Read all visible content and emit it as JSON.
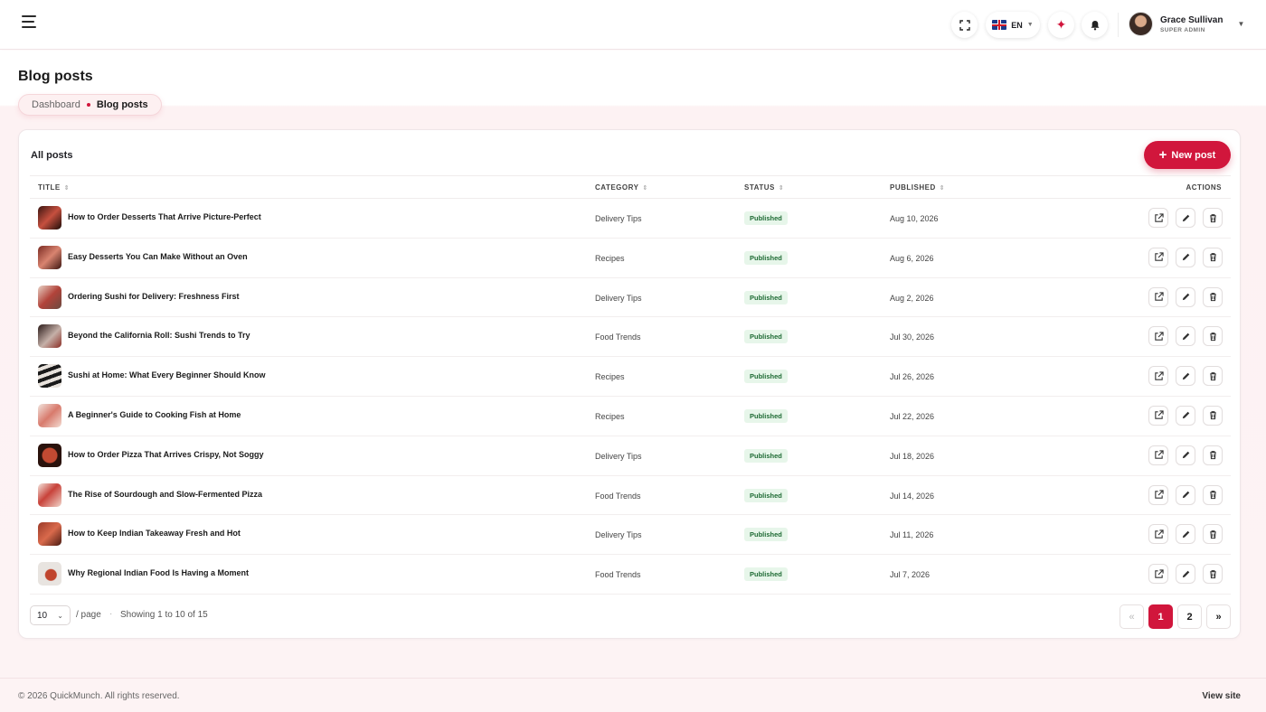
{
  "topbar": {
    "language": "EN",
    "user": {
      "name": "Grace Sullivan",
      "role": "SUPER ADMIN"
    },
    "icons": [
      "menu-icon",
      "fullscreen-icon",
      "uk-flag-icon",
      "sparkle-icon",
      "bell-icon",
      "chevron-down-icon"
    ]
  },
  "page": {
    "title": "Blog posts",
    "breadcrumb": {
      "home": "Dashboard",
      "current": "Blog posts"
    }
  },
  "card": {
    "title": "All posts",
    "new_button": "New post",
    "columns": {
      "title": "TITLE",
      "category": "CATEGORY",
      "status": "STATUS",
      "published": "PUBLISHED",
      "actions": "ACTIONS"
    },
    "rows": [
      {
        "title": "How to Order Desserts That Arrive Picture-Perfect",
        "category": "Delivery Tips",
        "status": "Published",
        "published": "Aug 10, 2026"
      },
      {
        "title": "Easy Desserts You Can Make Without an Oven",
        "category": "Recipes",
        "status": "Published",
        "published": "Aug 6, 2026"
      },
      {
        "title": "Ordering Sushi for Delivery: Freshness First",
        "category": "Delivery Tips",
        "status": "Published",
        "published": "Aug 2, 2026"
      },
      {
        "title": "Beyond the California Roll: Sushi Trends to Try",
        "category": "Food Trends",
        "status": "Published",
        "published": "Jul 30, 2026"
      },
      {
        "title": "Sushi at Home: What Every Beginner Should Know",
        "category": "Recipes",
        "status": "Published",
        "published": "Jul 26, 2026"
      },
      {
        "title": "A Beginner's Guide to Cooking Fish at Home",
        "category": "Recipes",
        "status": "Published",
        "published": "Jul 22, 2026"
      },
      {
        "title": "How to Order Pizza That Arrives Crispy, Not Soggy",
        "category": "Delivery Tips",
        "status": "Published",
        "published": "Jul 18, 2026"
      },
      {
        "title": "The Rise of Sourdough and Slow-Fermented Pizza",
        "category": "Food Trends",
        "status": "Published",
        "published": "Jul 14, 2026"
      },
      {
        "title": "How to Keep Indian Takeaway Fresh and Hot",
        "category": "Delivery Tips",
        "status": "Published",
        "published": "Jul 11, 2026"
      },
      {
        "title": "Why Regional Indian Food Is Having a Moment",
        "category": "Food Trends",
        "status": "Published",
        "published": "Jul 7, 2026"
      }
    ],
    "pagination": {
      "per_page": "10",
      "per_page_label": "/ page",
      "separator": "·",
      "showing": "Showing 1 to 10 of 15",
      "prev": "«",
      "pages": [
        "1",
        "2"
      ],
      "current_page": "1",
      "next": "»"
    }
  },
  "footer": {
    "copyright": "© 2026 QuickMunch. All rights reserved.",
    "view_site": "View site"
  },
  "colors": {
    "accent": "#d1163c",
    "badge_bg": "#e7f6ea",
    "badge_text": "#1e6b34"
  }
}
